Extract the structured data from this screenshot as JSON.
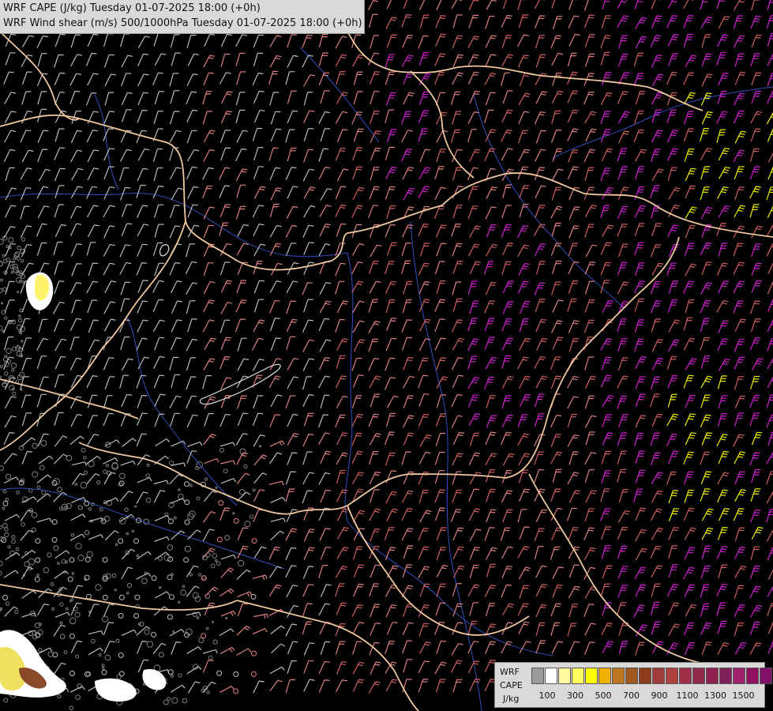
{
  "title": {
    "line1": "WRF CAPE (J/kg) Tuesday 01-07-2025 18:00 (+0h)",
    "line2": "WRF Wind shear (m/s) 500/1000hPa Tuesday 01-07-2025 18:00 (+0h)"
  },
  "legend": {
    "label1": "WRF",
    "label2": "CAPE",
    "label3": "J/kg",
    "colors": [
      "#9a9a9a",
      "#ffffff",
      "#fffaa0",
      "#ffff60",
      "#ffff00",
      "#f0b000",
      "#c07820",
      "#a05a20",
      "#8c3c1c",
      "#a03c3c",
      "#b04040",
      "#a03048",
      "#902848",
      "#902050",
      "#802058",
      "#a02070",
      "#901060",
      "#801068"
    ],
    "ticks": [
      "100",
      "300",
      "500",
      "700",
      "900",
      "1100",
      "1300",
      "1500"
    ]
  },
  "colors": {
    "background": "#000000",
    "border": "#f0c8a0",
    "river": "#3050c0",
    "barb_light": "#bcbcbc",
    "barb_pink": "#e08080",
    "barb_salmon": "#d06060",
    "barb_magenta": "#d020d0",
    "barb_yellow": "#f0f000",
    "terrain_gray": "#808080"
  }
}
